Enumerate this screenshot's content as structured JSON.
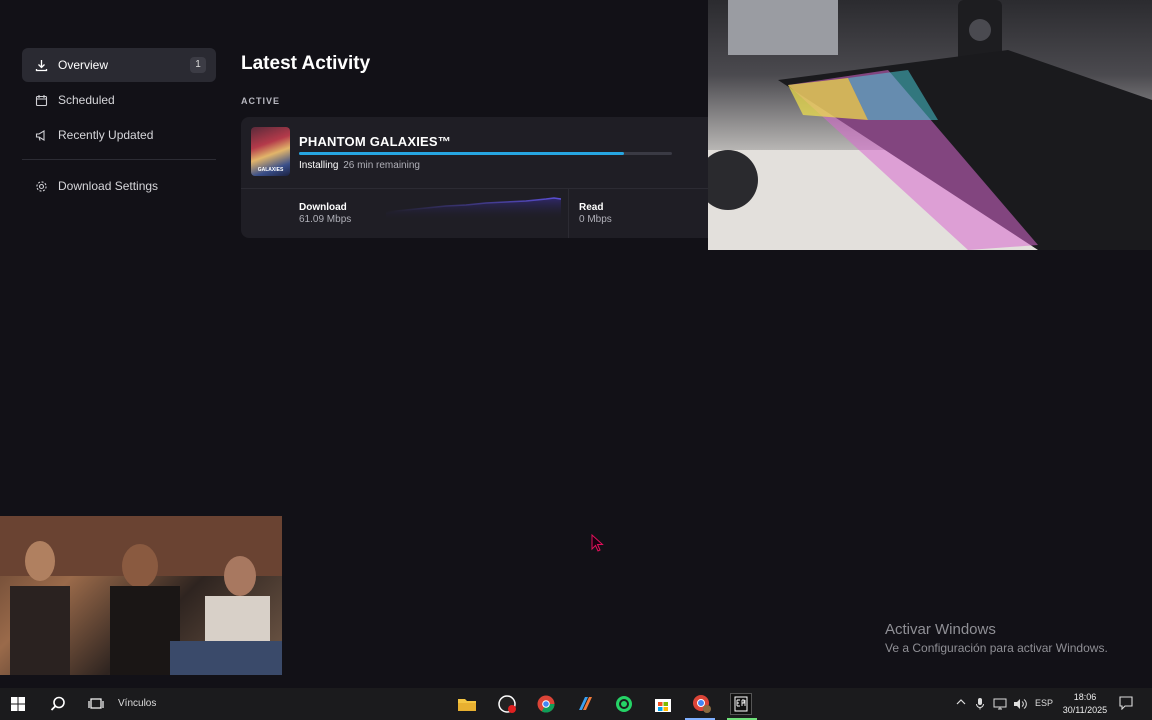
{
  "sidebar": {
    "items": [
      {
        "label": "Overview",
        "icon": "download-icon",
        "badge": "1",
        "active": true
      },
      {
        "label": "Scheduled",
        "icon": "calendar-icon"
      },
      {
        "label": "Recently Updated",
        "icon": "megaphone-icon"
      }
    ],
    "settings": {
      "label": "Download Settings",
      "icon": "gear-icon"
    }
  },
  "main": {
    "title": "Latest Activity",
    "section_label": "ACTIVE",
    "download": {
      "game_title": "PHANTOM GALAXIES™",
      "thumbnail_text": "GALAXIES",
      "status": "Installing",
      "remaining": "26 min remaining",
      "progress_fraction": 0.87,
      "download_label": "Download",
      "download_value": "61.09 Mbps",
      "read_label": "Read",
      "read_value": "0 Mbps",
      "accent_color": "#27a6e2"
    }
  },
  "watermark": {
    "line1": "Activar Windows",
    "line2": "Ve a Configuración para activar Windows."
  },
  "taskbar": {
    "links_label": "Vínculos",
    "language": "ESP",
    "time": "18:06",
    "date": "30/11/2025",
    "apps": [
      "file-explorer-icon",
      "obs-icon",
      "chrome-icon",
      "copilot-icon",
      "whatsapp-icon",
      "store-icon",
      "chrome-profile-icon",
      "epic-games-icon"
    ]
  }
}
